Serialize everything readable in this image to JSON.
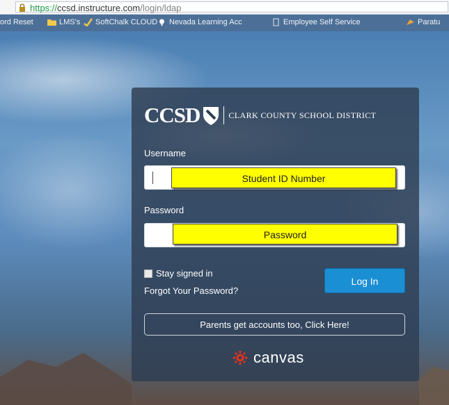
{
  "browser": {
    "url_scheme": "https://",
    "url_host": "ccsd.instructure.com",
    "url_path": "/login/ldap"
  },
  "bookmarks": [
    {
      "label": "ord Reset",
      "icon": "none"
    },
    {
      "label": "LMS's",
      "icon": "folder-icon"
    },
    {
      "label": "SoftChalk CLOUD",
      "icon": "softchalk-icon"
    },
    {
      "label": "Nevada Learning Acc",
      "icon": "nevada-icon"
    },
    {
      "label": "Employee Self Service",
      "icon": "page-icon"
    },
    {
      "label": "Paratu",
      "icon": "paratu-icon"
    }
  ],
  "login": {
    "logo_text": "CCSD",
    "district_name": "CLARK COUNTY SCHOOL DISTRICT",
    "username_label": "Username",
    "username_hint": "Student ID Number",
    "password_label": "Password",
    "password_hint": "Password",
    "stay_signed_in": "Stay signed in",
    "forgot_password": "Forgot Your Password?",
    "login_button": "Log In",
    "parents_button": "Parents get accounts too, Click Here!",
    "brand": "canvas"
  },
  "colors": {
    "login_button": "#1b8fd4",
    "card": "#2e3d52",
    "highlight": "#ffff00",
    "canvas_red": "#e1341e"
  }
}
